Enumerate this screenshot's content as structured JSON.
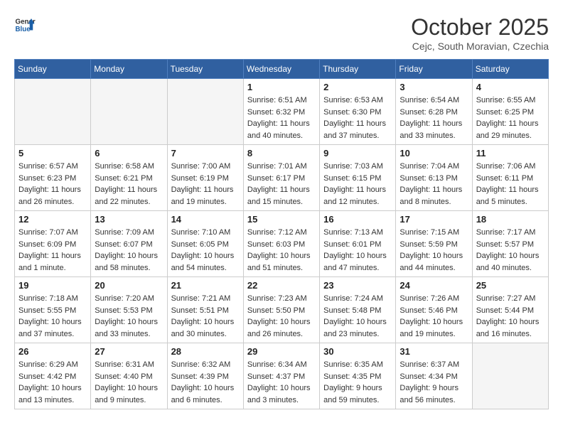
{
  "header": {
    "logo_line1": "General",
    "logo_line2": "Blue",
    "month": "October 2025",
    "location": "Cejc, South Moravian, Czechia"
  },
  "weekdays": [
    "Sunday",
    "Monday",
    "Tuesday",
    "Wednesday",
    "Thursday",
    "Friday",
    "Saturday"
  ],
  "weeks": [
    [
      {
        "day": "",
        "info": "",
        "empty": true
      },
      {
        "day": "",
        "info": "",
        "empty": true
      },
      {
        "day": "",
        "info": "",
        "empty": true
      },
      {
        "day": "1",
        "info": "Sunrise: 6:51 AM\nSunset: 6:32 PM\nDaylight: 11 hours\nand 40 minutes."
      },
      {
        "day": "2",
        "info": "Sunrise: 6:53 AM\nSunset: 6:30 PM\nDaylight: 11 hours\nand 37 minutes."
      },
      {
        "day": "3",
        "info": "Sunrise: 6:54 AM\nSunset: 6:28 PM\nDaylight: 11 hours\nand 33 minutes."
      },
      {
        "day": "4",
        "info": "Sunrise: 6:55 AM\nSunset: 6:25 PM\nDaylight: 11 hours\nand 29 minutes."
      }
    ],
    [
      {
        "day": "5",
        "info": "Sunrise: 6:57 AM\nSunset: 6:23 PM\nDaylight: 11 hours\nand 26 minutes."
      },
      {
        "day": "6",
        "info": "Sunrise: 6:58 AM\nSunset: 6:21 PM\nDaylight: 11 hours\nand 22 minutes."
      },
      {
        "day": "7",
        "info": "Sunrise: 7:00 AM\nSunset: 6:19 PM\nDaylight: 11 hours\nand 19 minutes."
      },
      {
        "day": "8",
        "info": "Sunrise: 7:01 AM\nSunset: 6:17 PM\nDaylight: 11 hours\nand 15 minutes."
      },
      {
        "day": "9",
        "info": "Sunrise: 7:03 AM\nSunset: 6:15 PM\nDaylight: 11 hours\nand 12 minutes."
      },
      {
        "day": "10",
        "info": "Sunrise: 7:04 AM\nSunset: 6:13 PM\nDaylight: 11 hours\nand 8 minutes."
      },
      {
        "day": "11",
        "info": "Sunrise: 7:06 AM\nSunset: 6:11 PM\nDaylight: 11 hours\nand 5 minutes."
      }
    ],
    [
      {
        "day": "12",
        "info": "Sunrise: 7:07 AM\nSunset: 6:09 PM\nDaylight: 11 hours\nand 1 minute."
      },
      {
        "day": "13",
        "info": "Sunrise: 7:09 AM\nSunset: 6:07 PM\nDaylight: 10 hours\nand 58 minutes."
      },
      {
        "day": "14",
        "info": "Sunrise: 7:10 AM\nSunset: 6:05 PM\nDaylight: 10 hours\nand 54 minutes."
      },
      {
        "day": "15",
        "info": "Sunrise: 7:12 AM\nSunset: 6:03 PM\nDaylight: 10 hours\nand 51 minutes."
      },
      {
        "day": "16",
        "info": "Sunrise: 7:13 AM\nSunset: 6:01 PM\nDaylight: 10 hours\nand 47 minutes."
      },
      {
        "day": "17",
        "info": "Sunrise: 7:15 AM\nSunset: 5:59 PM\nDaylight: 10 hours\nand 44 minutes."
      },
      {
        "day": "18",
        "info": "Sunrise: 7:17 AM\nSunset: 5:57 PM\nDaylight: 10 hours\nand 40 minutes."
      }
    ],
    [
      {
        "day": "19",
        "info": "Sunrise: 7:18 AM\nSunset: 5:55 PM\nDaylight: 10 hours\nand 37 minutes."
      },
      {
        "day": "20",
        "info": "Sunrise: 7:20 AM\nSunset: 5:53 PM\nDaylight: 10 hours\nand 33 minutes."
      },
      {
        "day": "21",
        "info": "Sunrise: 7:21 AM\nSunset: 5:51 PM\nDaylight: 10 hours\nand 30 minutes."
      },
      {
        "day": "22",
        "info": "Sunrise: 7:23 AM\nSunset: 5:50 PM\nDaylight: 10 hours\nand 26 minutes."
      },
      {
        "day": "23",
        "info": "Sunrise: 7:24 AM\nSunset: 5:48 PM\nDaylight: 10 hours\nand 23 minutes."
      },
      {
        "day": "24",
        "info": "Sunrise: 7:26 AM\nSunset: 5:46 PM\nDaylight: 10 hours\nand 19 minutes."
      },
      {
        "day": "25",
        "info": "Sunrise: 7:27 AM\nSunset: 5:44 PM\nDaylight: 10 hours\nand 16 minutes."
      }
    ],
    [
      {
        "day": "26",
        "info": "Sunrise: 6:29 AM\nSunset: 4:42 PM\nDaylight: 10 hours\nand 13 minutes."
      },
      {
        "day": "27",
        "info": "Sunrise: 6:31 AM\nSunset: 4:40 PM\nDaylight: 10 hours\nand 9 minutes."
      },
      {
        "day": "28",
        "info": "Sunrise: 6:32 AM\nSunset: 4:39 PM\nDaylight: 10 hours\nand 6 minutes."
      },
      {
        "day": "29",
        "info": "Sunrise: 6:34 AM\nSunset: 4:37 PM\nDaylight: 10 hours\nand 3 minutes."
      },
      {
        "day": "30",
        "info": "Sunrise: 6:35 AM\nSunset: 4:35 PM\nDaylight: 9 hours\nand 59 minutes."
      },
      {
        "day": "31",
        "info": "Sunrise: 6:37 AM\nSunset: 4:34 PM\nDaylight: 9 hours\nand 56 minutes."
      },
      {
        "day": "",
        "info": "",
        "empty": true
      }
    ]
  ]
}
